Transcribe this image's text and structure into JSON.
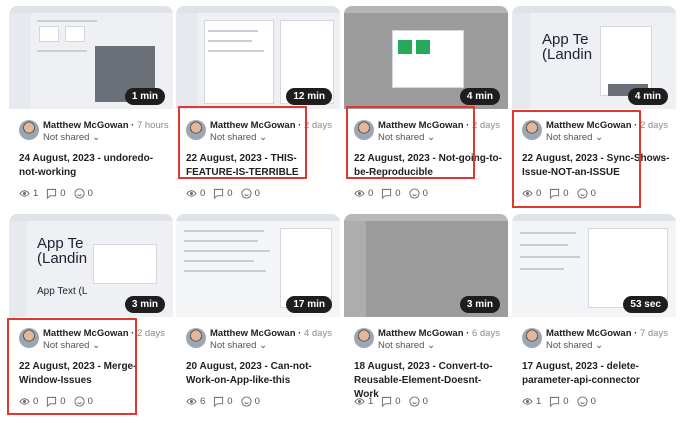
{
  "cards": [
    {
      "duration": "1 min",
      "author": "Matthew McGowan",
      "age": "7 hours",
      "share": "Not shared",
      "title": "24 August, 2023 - undoredo-not-working",
      "views": "1",
      "comments": "0",
      "reactions": "0"
    },
    {
      "duration": "12 min",
      "author": "Matthew McGowan",
      "age": "2 days",
      "share": "Not shared",
      "title": "22 August, 2023 - THIS-FEATURE-IS-TERRIBLE",
      "views": "0",
      "comments": "0",
      "reactions": "0"
    },
    {
      "duration": "4 min",
      "author": "Matthew McGowan",
      "age": "2 days",
      "share": "Not shared",
      "title": "22 August, 2023 - Not-going-to-be-Reproducible",
      "views": "0",
      "comments": "0",
      "reactions": "0"
    },
    {
      "duration": "4 min",
      "author": "Matthew McGowan",
      "age": "2 days",
      "share": "Not shared",
      "title": "22 August, 2023 - Sync-Shows-Issue-NOT-an-ISSUE",
      "views": "0",
      "comments": "0",
      "reactions": "0"
    },
    {
      "duration": "3 min",
      "author": "Matthew McGowan",
      "age": "2 days",
      "share": "Not shared",
      "title": "22 August, 2023 - Merge-Window-Issues",
      "views": "0",
      "comments": "0",
      "reactions": "0"
    },
    {
      "duration": "17 min",
      "author": "Matthew McGowan",
      "age": "4 days",
      "share": "Not shared",
      "title": "20 August, 2023 - Can-not-Work-on-App-like-this",
      "views": "6",
      "comments": "0",
      "reactions": "0"
    },
    {
      "duration": "3 min",
      "author": "Matthew McGowan",
      "age": "6 days",
      "share": "Not shared",
      "title": "18 August, 2023 - Convert-to-Reusable-Element-Doesnt-Work",
      "views": "1",
      "comments": "0",
      "reactions": "0"
    },
    {
      "duration": "53 sec",
      "author": "Matthew McGowan",
      "age": "7 days",
      "share": "Not shared",
      "title": "17 August, 2023 - delete-parameter-api-connector",
      "views": "1",
      "comments": "0",
      "reactions": "0"
    }
  ],
  "thumb_text": {
    "app_text": "App Te",
    "landing": "(Landin",
    "app_text_small": "App Text (L"
  },
  "colors": {
    "highlight": "#e0382e",
    "badge": "#1e1e1e"
  }
}
